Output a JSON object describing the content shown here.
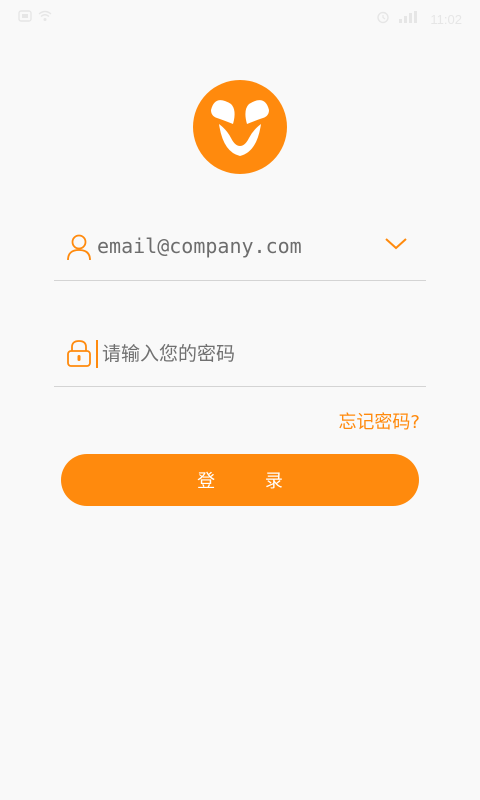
{
  "status_bar": {
    "left_icons": [
      "sim-icon",
      "wifi-icon"
    ],
    "right_icons": [
      "alarm-icon",
      "signal-icon"
    ],
    "time": "11:02"
  },
  "colors": {
    "accent": "#ff8a0d",
    "background": "#f9f9f9",
    "divider": "#d4d4d4"
  },
  "login_form": {
    "email_value": "email@company.com",
    "password_placeholder": "请输入您的密码",
    "forgot_password": "忘记密码?",
    "login_button": "登 录"
  }
}
